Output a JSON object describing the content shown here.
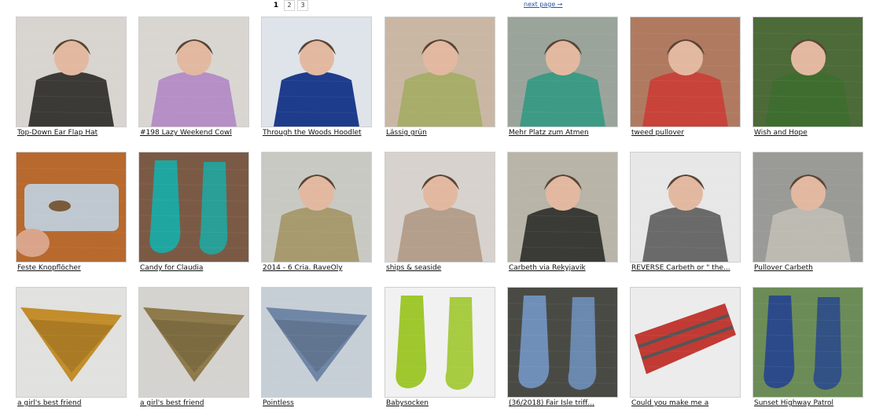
{
  "pagination": {
    "pages": [
      "1",
      "2",
      "3"
    ],
    "current": "1",
    "next_label": "next page →"
  },
  "patterns": [
    {
      "title": "Top-Down Ear Flap Hat",
      "thumb": "woman-hat",
      "bg": "#d8d4cf",
      "fg": "#3b3a36"
    },
    {
      "title": "#198 Lazy Weekend Cowl",
      "thumb": "lilac-cowl",
      "bg": "#d9d6d2",
      "fg": "#b58fc6"
    },
    {
      "title": "Through the Woods Hoodlet",
      "thumb": "blue-hood",
      "bg": "#dfe3ea",
      "fg": "#1e3c8c"
    },
    {
      "title": "Lässig grün",
      "thumb": "green-sweater",
      "bg": "#c9b7a4",
      "fg": "#a8ad6a"
    },
    {
      "title": "Mehr Platz zum Atmen",
      "thumb": "teal-tunic",
      "bg": "#9aa49b",
      "fg": "#3d9a84"
    },
    {
      "title": "tweed pullover",
      "thumb": "red-pullover",
      "bg": "#b07a61",
      "fg": "#c8433a"
    },
    {
      "title": "Wish and Hope",
      "thumb": "green-cardigan",
      "bg": "#4d6a39",
      "fg": "#3f6d2f"
    },
    {
      "title": "Feste Knopflöcher",
      "thumb": "buttonhole",
      "bg": "#b8692e",
      "fg": "#bfc8d0"
    },
    {
      "title": "Candy for Claudia",
      "thumb": "teal-socks",
      "bg": "#7b5a45",
      "fg": "#1fa6a0"
    },
    {
      "title": "2014 - 6 Cria. RaveOly",
      "thumb": "olive-cardigan",
      "bg": "#c9c9c4",
      "fg": "#a79a6e"
    },
    {
      "title": "ships & seaside",
      "thumb": "woman-cowl",
      "bg": "#d7d2cd",
      "fg": "#b49e8c"
    },
    {
      "title": "Carbeth via Rekyjavik",
      "thumb": "striped-vest",
      "bg": "#b8b4a8",
      "fg": "#3a3b36"
    },
    {
      "title": "REVERSE Carbeth or \" the...",
      "thumb": "grey-pullover",
      "bg": "#e7e7e7",
      "fg": "#6a6a6a"
    },
    {
      "title": "Pullover Carbeth",
      "thumb": "grey-knit",
      "bg": "#9a9a96",
      "fg": "#bdbab2"
    },
    {
      "title": "a girl's best friend",
      "thumb": "shawl-1",
      "bg": "#e1e1df",
      "fg": "#c28d2a"
    },
    {
      "title": "a girl's best friend",
      "thumb": "shawl-2",
      "bg": "#d4d3d0",
      "fg": "#8e7a4a"
    },
    {
      "title": "Pointless",
      "thumb": "blue-shawl",
      "bg": "#c7cfd6",
      "fg": "#6f86a6"
    },
    {
      "title": "Babysocken",
      "thumb": "lime-socks",
      "bg": "#f1f1f1",
      "fg": "#9fc72e"
    },
    {
      "title": "(36/2018) Fair Isle triff...",
      "thumb": "blue-socks",
      "bg": "#4a4a45",
      "fg": "#6f8fb9"
    },
    {
      "title": "Could you make me a",
      "thumb": "red-scarf",
      "bg": "#ececec",
      "fg": "#c23a34"
    },
    {
      "title": "Sunset Highway Patrol",
      "thumb": "colorwork-socks",
      "bg": "#6b8c57",
      "fg": "#2c4a8a"
    }
  ]
}
